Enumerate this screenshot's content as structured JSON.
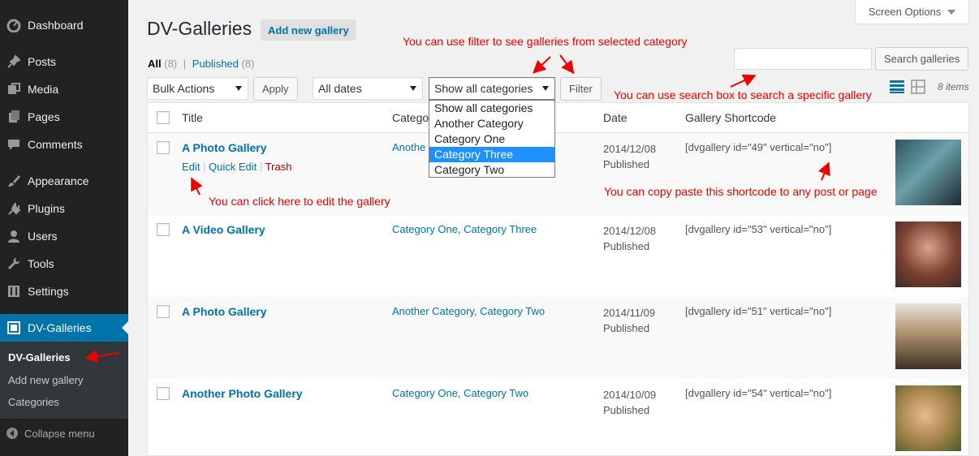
{
  "sidebar": {
    "items": [
      {
        "label": "Dashboard",
        "icon": "dashboard-icon"
      },
      {
        "label": "Posts",
        "icon": "pin-icon"
      },
      {
        "label": "Media",
        "icon": "media-icon"
      },
      {
        "label": "Pages",
        "icon": "pages-icon"
      },
      {
        "label": "Comments",
        "icon": "comment-icon"
      },
      {
        "label": "Appearance",
        "icon": "brush-icon"
      },
      {
        "label": "Plugins",
        "icon": "plugin-icon"
      },
      {
        "label": "Users",
        "icon": "user-icon"
      },
      {
        "label": "Tools",
        "icon": "wrench-icon"
      },
      {
        "label": "Settings",
        "icon": "settings-icon"
      },
      {
        "label": "DV-Galleries",
        "icon": "gallery-icon"
      }
    ],
    "submenu": [
      "DV-Galleries",
      "Add new gallery",
      "Categories"
    ],
    "collapse": "Collapse menu"
  },
  "header": {
    "title": "DV-Galleries",
    "add_new": "Add new gallery",
    "screen_options": "Screen Options"
  },
  "filters": {
    "all": "All",
    "all_count": "(8)",
    "sep": "|",
    "published": "Published",
    "published_count": "(8)",
    "bulk": "Bulk Actions",
    "apply": "Apply",
    "dates": "All dates",
    "category": "Show all categories",
    "filter_btn": "Filter",
    "search_btn": "Search galleries",
    "search_value": "",
    "items_count": "8 items"
  },
  "dropdown": {
    "options": [
      "Show all categories",
      "Another Category",
      "Category One",
      "Category Three",
      "Category Two"
    ],
    "highlighted": "Category Three"
  },
  "table": {
    "headers": {
      "title": "Title",
      "category": "Catego",
      "date": "Date",
      "shortcode": "Gallery Shortcode"
    },
    "row_actions": {
      "edit": "Edit",
      "quick_edit": "Quick Edit",
      "trash": "Trash",
      "sep": "|"
    },
    "rows": [
      {
        "title": "A Photo Gallery",
        "category": "Anothe",
        "date": "2014/12/08",
        "status": "Published",
        "shortcode": "[dvgallery id=\"49\" vertical=\"no\"]",
        "thumb_color": "#3f6f7a"
      },
      {
        "title": "A Video Gallery",
        "category": "Category One, Category Three",
        "date": "2014/12/08",
        "status": "Published",
        "shortcode": "[dvgallery id=\"53\" vertical=\"no\"]",
        "thumb_color": "#8a5a48"
      },
      {
        "title": "A Photo Gallery",
        "category": "Another Category, Category Two",
        "date": "2014/11/09",
        "status": "Published",
        "shortcode": "[dvgallery id=\"51\" vertical=\"no\"]",
        "thumb_color": "#5b4a3c"
      },
      {
        "title": "Another Photo Gallery",
        "category": "Category One, Category Two",
        "date": "2014/10/09",
        "status": "Published",
        "shortcode": "[dvgallery id=\"54\" vertical=\"no\"]",
        "thumb_color": "#8a8f5a"
      }
    ]
  },
  "notes": {
    "filter": "You can use filter to see galleries from selected category",
    "search": "You can use search box to search a specific gallery",
    "edit": "You can click here to edit the gallery",
    "shortcode": "You can copy paste this shortcode to any post or page"
  },
  "colors": {
    "accent": "#0073aa",
    "annotation": "#e00000",
    "sidebar": "#222222"
  }
}
